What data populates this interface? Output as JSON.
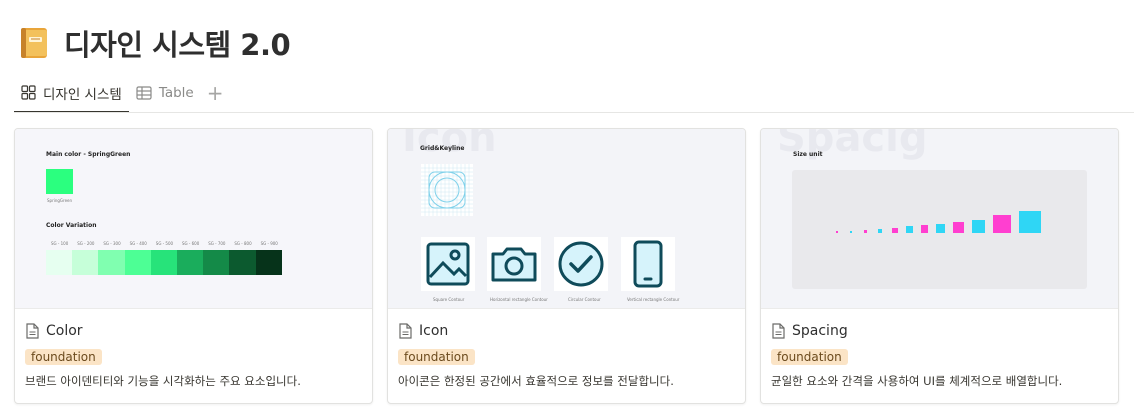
{
  "page": {
    "title": "디자인 시스템 2.0",
    "icon": "notebook-icon"
  },
  "tabs": [
    {
      "label": "디자인 시스템",
      "icon": "gallery-icon",
      "active": true
    },
    {
      "label": "Table",
      "icon": "table-icon",
      "active": false
    }
  ],
  "add_view_label": "+",
  "cards": [
    {
      "title": "Color",
      "tag": "foundation",
      "description": "브랜드 아이덴티티와 기능을 시각화하는 주요 요소입니다.",
      "preview": {
        "main_label": "Main color - SpringGreen",
        "swatch_name": "SpringGreen",
        "variation_label": "Color Variation",
        "variation_steps": [
          "SG - 100",
          "SG - 200",
          "SG - 300",
          "SG - 400",
          "SG - 500",
          "SG - 600",
          "SG - 700",
          "SG - 800",
          "SG - 900"
        ],
        "variation_colors": [
          "#e6fff0",
          "#c6ffd9",
          "#80ffb0",
          "#4dff95",
          "#27e37a",
          "#1aad5c",
          "#148a48",
          "#0c5a2f",
          "#06331a"
        ],
        "main_color": "#2bff7f"
      }
    },
    {
      "title": "Icon",
      "tag": "foundation",
      "description": "아이콘은 한정된 공간에서 효율적으로 정보를 전달합니다.",
      "preview": {
        "watermark": "Icon",
        "section_label": "Grid&Keyline",
        "icons": [
          {
            "name": "image-icon",
            "caption": "Square Contour"
          },
          {
            "name": "camera-icon",
            "caption": "Horizontal rectangle Contour"
          },
          {
            "name": "check-circle-icon",
            "caption": "Circular Contour"
          },
          {
            "name": "phone-icon",
            "caption": "Vertical rectangle Contour"
          }
        ]
      }
    },
    {
      "title": "Spacing",
      "tag": "foundation",
      "description": "균일한 요소와 간격을 사용하여 UI를 체계적으로 배열합니다.",
      "preview": {
        "watermark": "Spacig",
        "section_label": "Size unit",
        "steps": [
          2,
          4,
          6,
          8,
          10,
          12,
          14,
          16,
          20,
          24,
          32,
          40
        ]
      }
    }
  ],
  "colors": {
    "tag_bg": "#fbe4c6",
    "accent_cyan": "#2fd6f5",
    "accent_pink": "#ff3fd0"
  }
}
